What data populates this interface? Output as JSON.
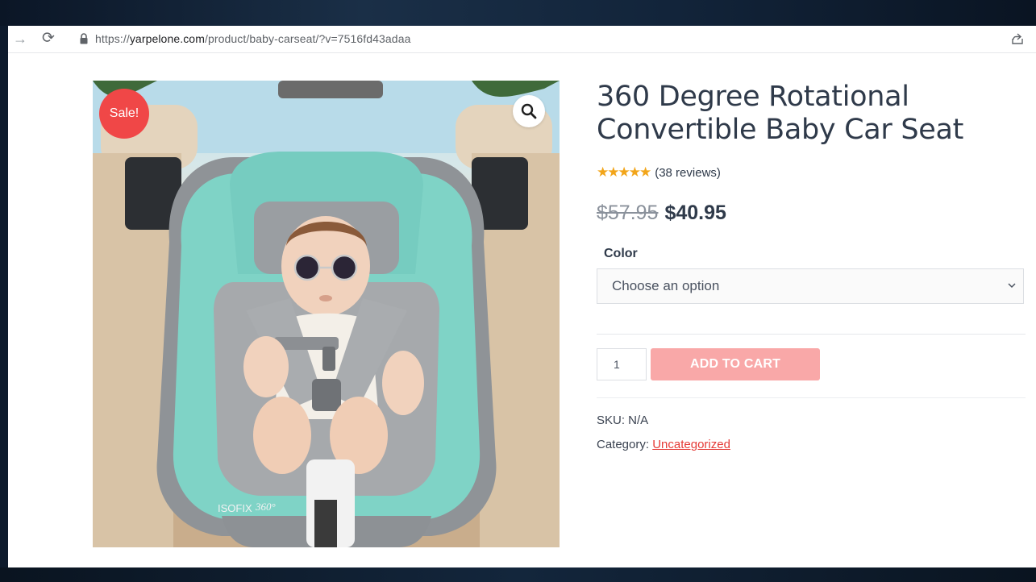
{
  "browser": {
    "url_prefix": "https://",
    "url_host": "yarpelone.com",
    "url_path": "/product/baby-carseat/?v=7516fd43adaa"
  },
  "product": {
    "sale_badge": "Sale!",
    "title": "360 Degree Rotational Convertible Baby Car Seat",
    "rating": 5,
    "reviews_text": "(38 reviews)",
    "old_price": "$57.95",
    "new_price": "$40.95",
    "color_label": "Color",
    "color_placeholder": "Choose an option",
    "quantity": "1",
    "add_to_cart_label": "ADD TO CART",
    "sku_text": "SKU: N/A",
    "category_label": "Category:",
    "category_link": "Uncategorized",
    "image_seat_text": "ISOFIX",
    "image_seat_brand": "360°"
  },
  "colors": {
    "sale": "#f04747",
    "add_to_cart": "#f9a8a8",
    "star": "#f2a51a",
    "link": "#e53935",
    "seat_teal": "#7fd3c6",
    "seat_grey": "#9a9a9a"
  },
  "icons": {
    "back": "arrow-right-icon",
    "reload": "reload-icon",
    "lock": "lock-icon",
    "share": "share-icon",
    "zoom": "magnifier-icon",
    "chevron": "chevron-down-icon"
  }
}
